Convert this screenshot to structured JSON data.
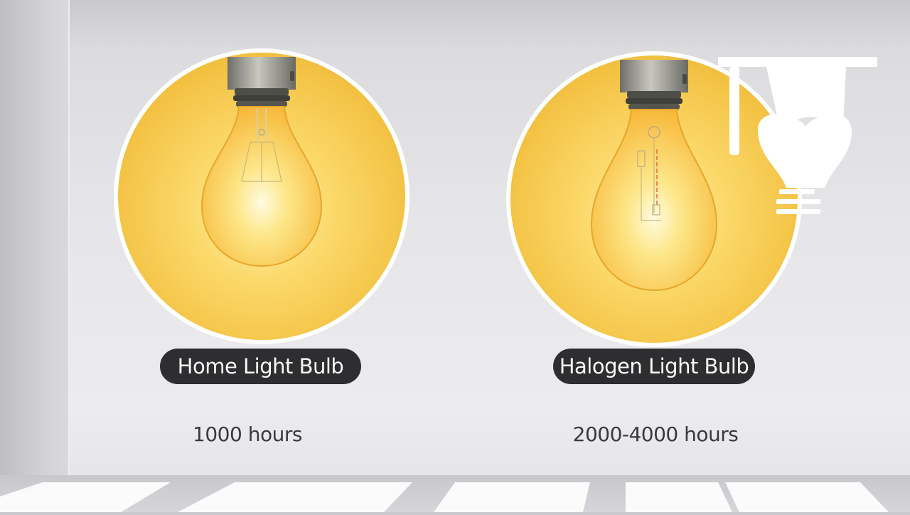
{
  "bulbs": [
    {
      "name": "Home Light Bulb",
      "lifetime": "1000 hours"
    },
    {
      "name": "Halogen Light Bulb",
      "lifetime": "2000-4000 hours"
    }
  ],
  "colors": {
    "glow_outer": "#f5c94a",
    "glow_inner": "#fdf1a8",
    "label_bg": "#2e2e30",
    "label_text": "#fafafa",
    "text": "#3a3a3c"
  },
  "icons": [
    "graduation-cap-lightbulb-icon",
    "incandescent-bulb-illustration",
    "halogen-bulb-illustration"
  ]
}
